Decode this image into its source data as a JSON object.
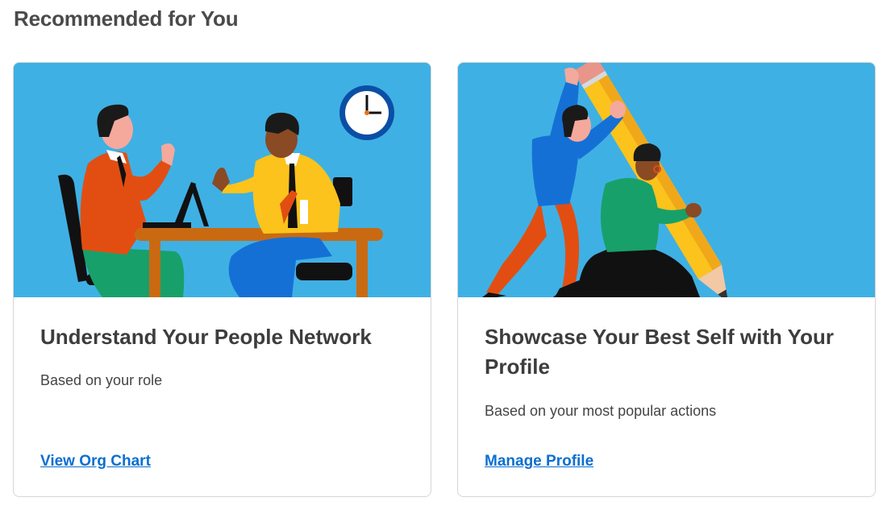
{
  "section": {
    "title": "Recommended for You"
  },
  "cards": [
    {
      "title": "Understand Your People Network",
      "subtitle": "Based on your role",
      "link": "View Org Chart",
      "illustration": "meeting-illustration"
    },
    {
      "title": "Showcase Your Best Self with Your Profile",
      "subtitle": "Based on your most popular actions",
      "link": "Manage Profile",
      "illustration": "pencil-illustration"
    }
  ],
  "colors": {
    "illustration_bg": "#3fb0e4",
    "link": "#0b6fd0",
    "title": "#3d3d3d",
    "card_border": "#d6d6d6"
  }
}
